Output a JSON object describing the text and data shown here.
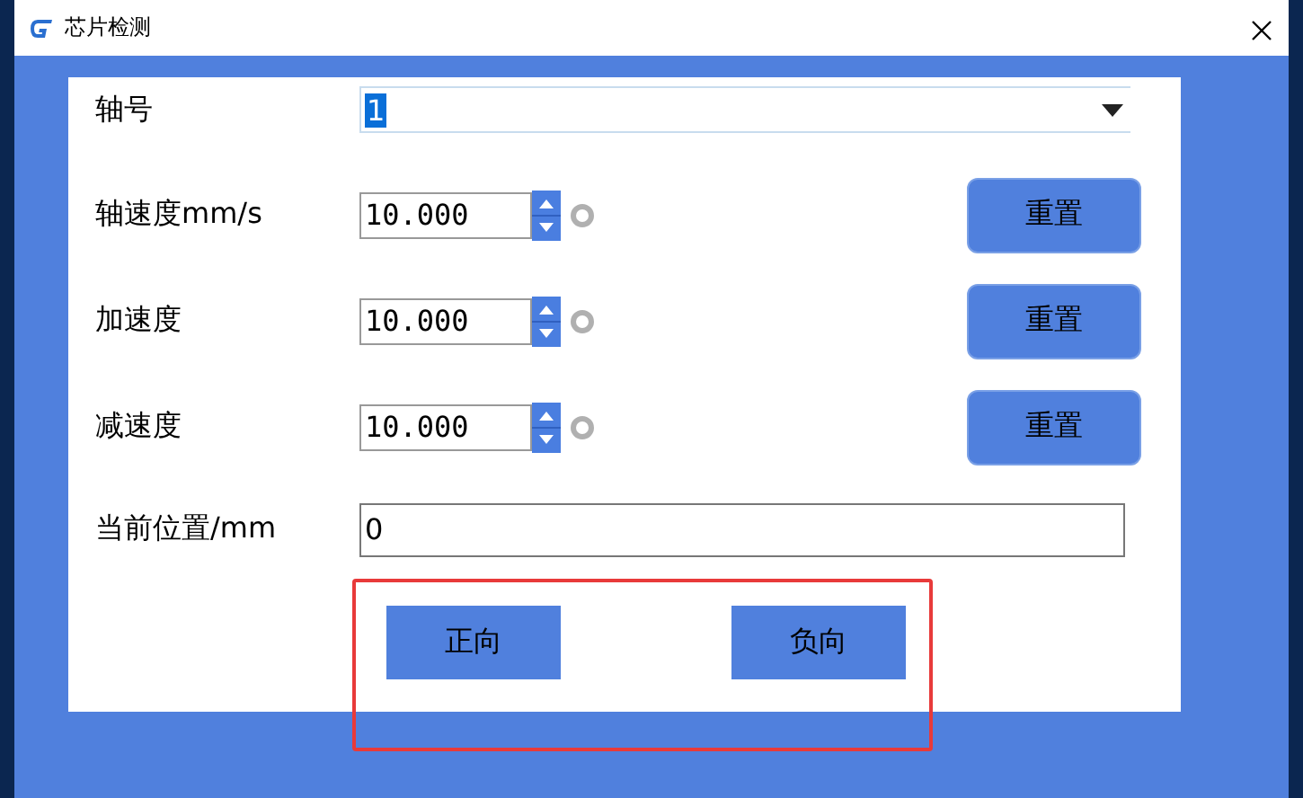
{
  "window": {
    "title": "芯片检测"
  },
  "axis": {
    "label": "轴号",
    "value": "1"
  },
  "params": [
    {
      "label": "轴速度mm/s",
      "value": "10.000",
      "button": "重置"
    },
    {
      "label": "加速度",
      "value": "10.000",
      "button": "重置"
    },
    {
      "label": "减速度",
      "value": "10.000",
      "button": "重置"
    }
  ],
  "position": {
    "label": "当前位置/mm",
    "value": "0"
  },
  "buttons": [
    "正向",
    "负向"
  ]
}
